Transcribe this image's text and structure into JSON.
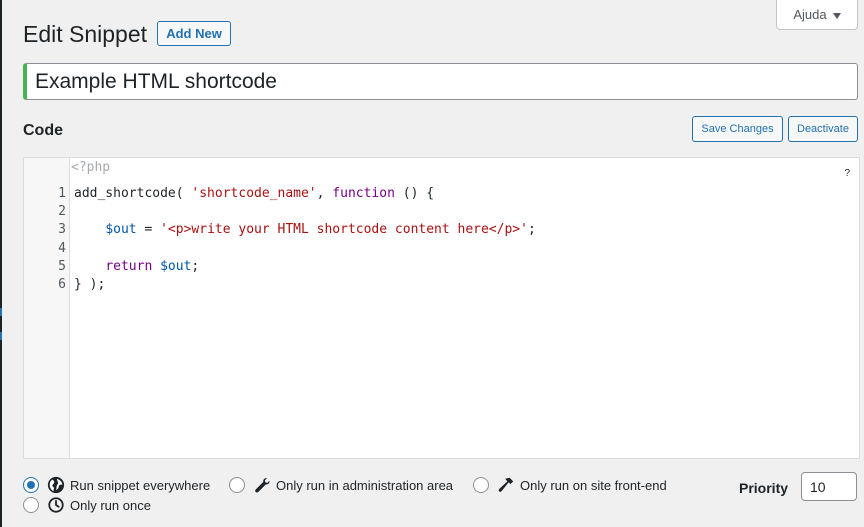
{
  "help_tab": {
    "label": "Ajuda"
  },
  "header": {
    "title": "Edit Snippet",
    "add_new_label": "Add New"
  },
  "snippet": {
    "title": "Example HTML shortcode"
  },
  "code_section": {
    "heading": "Code",
    "save_label": "Save Changes",
    "deactivate_label": "Deactivate",
    "php_open_tag": "<?php",
    "help_glyph": "?",
    "lines": [
      {
        "n": "1",
        "tokens": [
          {
            "t": "add_shortcode( ",
            "c": ""
          },
          {
            "t": "'shortcode_name'",
            "c": "str"
          },
          {
            "t": ", ",
            "c": ""
          },
          {
            "t": "function",
            "c": "kw"
          },
          {
            "t": " () {",
            "c": ""
          }
        ]
      },
      {
        "n": "2",
        "tokens": []
      },
      {
        "n": "3",
        "tokens": [
          {
            "t": "    ",
            "c": ""
          },
          {
            "t": "$out",
            "c": "var"
          },
          {
            "t": " = ",
            "c": ""
          },
          {
            "t": "'<p>write your HTML shortcode content here</p>'",
            "c": "str"
          },
          {
            "t": ";",
            "c": ""
          }
        ]
      },
      {
        "n": "4",
        "tokens": []
      },
      {
        "n": "5",
        "tokens": [
          {
            "t": "    ",
            "c": ""
          },
          {
            "t": "return",
            "c": "kw"
          },
          {
            "t": " ",
            "c": ""
          },
          {
            "t": "$out",
            "c": "var"
          },
          {
            "t": ";",
            "c": ""
          }
        ]
      },
      {
        "n": "6",
        "tokens": [
          {
            "t": "} );",
            "c": ""
          }
        ]
      }
    ]
  },
  "scope": {
    "selected": "everywhere",
    "options": [
      {
        "id": "everywhere",
        "label": "Run snippet everywhere",
        "icon": "globe-icon"
      },
      {
        "id": "admin",
        "label": "Only run in administration area",
        "icon": "wrench-icon"
      },
      {
        "id": "front-end",
        "label": "Only run on site front-end",
        "icon": "hammer-icon"
      },
      {
        "id": "single-use",
        "label": "Only run once",
        "icon": "clock-icon"
      }
    ]
  },
  "priority": {
    "label": "Priority",
    "value": "10"
  },
  "colors": {
    "accent": "#2271b1",
    "active_title_border": "#46b450",
    "code_string": "#aa1111",
    "code_keyword": "#770088",
    "code_variable": "#0055aa"
  }
}
